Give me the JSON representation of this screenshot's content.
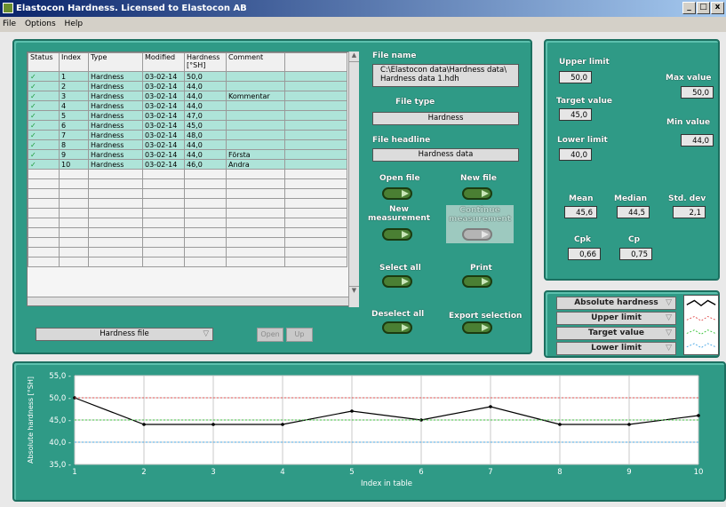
{
  "window": {
    "title": "Elastocon Hardness. Licensed to Elastocon AB",
    "controls": [
      "_",
      "□",
      "x"
    ]
  },
  "menu": [
    "File",
    "Options",
    "Help"
  ],
  "table": {
    "headers": [
      "Status",
      "Index",
      "Type",
      "Modified",
      "Hardness\n[°SH]",
      "Comment"
    ],
    "rows": [
      {
        "status": "✓",
        "index": "1",
        "type": "Hardness",
        "modified": "03-02-14",
        "hardness": "50,0",
        "comment": ""
      },
      {
        "status": "✓",
        "index": "2",
        "type": "Hardness",
        "modified": "03-02-14",
        "hardness": "44,0",
        "comment": ""
      },
      {
        "status": "✓",
        "index": "3",
        "type": "Hardness",
        "modified": "03-02-14",
        "hardness": "44,0",
        "comment": "Kommentar"
      },
      {
        "status": "✓",
        "index": "4",
        "type": "Hardness",
        "modified": "03-02-14",
        "hardness": "44,0",
        "comment": ""
      },
      {
        "status": "✓",
        "index": "5",
        "type": "Hardness",
        "modified": "03-02-14",
        "hardness": "47,0",
        "comment": ""
      },
      {
        "status": "✓",
        "index": "6",
        "type": "Hardness",
        "modified": "03-02-14",
        "hardness": "45,0",
        "comment": ""
      },
      {
        "status": "✓",
        "index": "7",
        "type": "Hardness",
        "modified": "03-02-14",
        "hardness": "48,0",
        "comment": ""
      },
      {
        "status": "✓",
        "index": "8",
        "type": "Hardness",
        "modified": "03-02-14",
        "hardness": "44,0",
        "comment": ""
      },
      {
        "status": "✓",
        "index": "9",
        "type": "Hardness",
        "modified": "03-02-14",
        "hardness": "44,0",
        "comment": "Första"
      },
      {
        "status": "✓",
        "index": "10",
        "type": "Hardness",
        "modified": "03-02-14",
        "hardness": "46,0",
        "comment": "Andra"
      }
    ],
    "empty_rows": 10
  },
  "bottom_controls": {
    "file_select": "Hardness file",
    "open_label": "Open",
    "up_label": "Up"
  },
  "file": {
    "name_label": "File name",
    "name_value": "C:\\Elastocon data\\Hardness data\\ Hardness data 1.hdh",
    "type_label": "File type",
    "type_value": "Hardness",
    "headline_label": "File headline",
    "headline_value": "Hardness data"
  },
  "buttons": {
    "open_file": "Open file",
    "new_file": "New file",
    "new_measurement": "New measurement",
    "continue_measurement": "Continue measurement",
    "select_all": "Select all",
    "print": "Print",
    "deselect_all": "Deselect all",
    "export_selection": "Export selection"
  },
  "stats": {
    "upper_limit_label": "Upper limit",
    "upper_limit": "50,0",
    "target_value_label": "Target value",
    "target_value": "45,0",
    "lower_limit_label": "Lower limit",
    "lower_limit": "40,0",
    "max_value_label": "Max value",
    "max_value": "50,0",
    "min_value_label": "Min value",
    "min_value": "44,0",
    "mean_label": "Mean",
    "mean": "45,6",
    "median_label": "Median",
    "median": "44,5",
    "stddev_label": "Std. dev",
    "stddev": "2,1",
    "cpk_label": "Cpk",
    "cpk": "0,66",
    "cp_label": "Cp",
    "cp": "0,75"
  },
  "legend": [
    "Absolute hardness",
    "Upper limit",
    "Target value",
    "Lower limit"
  ],
  "colors": {
    "panel": "#2f9a86",
    "upper": "#e05050",
    "target": "#3cc43c",
    "lower": "#4aa8e6",
    "series": "#000000"
  },
  "chart_data": {
    "type": "line",
    "xlabel": "Index in table",
    "ylabel": "Absolute hardness [°SH]",
    "x": [
      1,
      2,
      3,
      4,
      5,
      6,
      7,
      8,
      9,
      10
    ],
    "series": [
      {
        "name": "Absolute hardness",
        "values": [
          50,
          44,
          44,
          44,
          47,
          45,
          48,
          44,
          44,
          46
        ]
      },
      {
        "name": "Upper limit",
        "values": [
          50,
          50,
          50,
          50,
          50,
          50,
          50,
          50,
          50,
          50
        ]
      },
      {
        "name": "Target value",
        "values": [
          45,
          45,
          45,
          45,
          45,
          45,
          45,
          45,
          45,
          45
        ]
      },
      {
        "name": "Lower limit",
        "values": [
          40,
          40,
          40,
          40,
          40,
          40,
          40,
          40,
          40,
          40
        ]
      }
    ],
    "ylim": [
      35,
      55
    ],
    "yticks": [
      "35,0",
      "40,0",
      "45,0",
      "50,0",
      "55,0"
    ],
    "xticks": [
      "1",
      "2",
      "3",
      "4",
      "5",
      "6",
      "7",
      "8",
      "9",
      "10"
    ],
    "grid": true
  }
}
